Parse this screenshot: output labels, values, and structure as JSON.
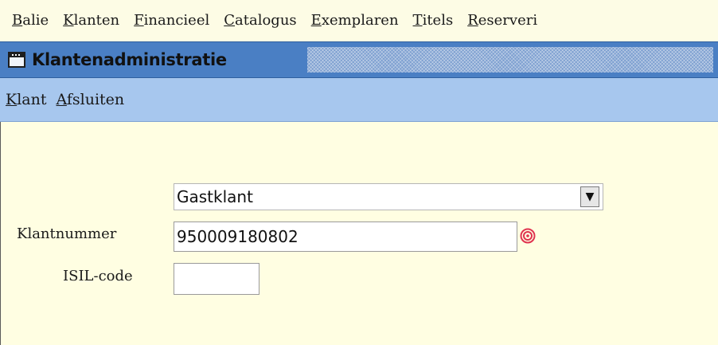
{
  "menubar": {
    "items": [
      {
        "key": "B",
        "rest": "alie"
      },
      {
        "key": "K",
        "rest": "lanten"
      },
      {
        "key": "F",
        "rest": "inancieel"
      },
      {
        "key": "C",
        "rest": "atalogus"
      },
      {
        "key": "E",
        "rest": "xemplaren"
      },
      {
        "key": "T",
        "rest": "itels"
      },
      {
        "key": "R",
        "rest": "eserveri"
      }
    ]
  },
  "window": {
    "title": "Klantenadministratie",
    "icon": "window-icon"
  },
  "submenu": {
    "items": [
      {
        "key": "K",
        "rest": "lant"
      },
      {
        "key": "A",
        "rest": "fsluiten"
      }
    ]
  },
  "form": {
    "type_select": {
      "value": "Gastklant",
      "arrow": "▼"
    },
    "klantnummer": {
      "label": "Klantnummer",
      "value": "950009180802",
      "icon": "required-target-icon"
    },
    "isil": {
      "label": "ISIL-code",
      "value": ""
    }
  },
  "colors": {
    "menubar_bg": "#fdfce5",
    "titlebar_bg": "#4a7fc4",
    "submenu_bg": "#a7c7ee",
    "content_bg": "#fffee2",
    "required_icon": "#e0334f"
  }
}
